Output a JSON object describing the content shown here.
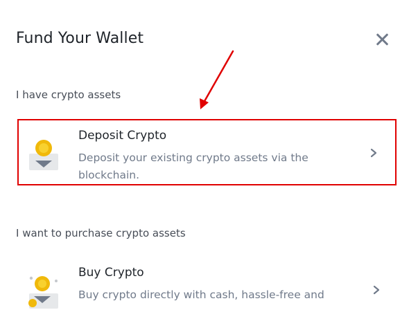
{
  "dialog": {
    "title": "Fund Your Wallet",
    "close_icon": "close-icon"
  },
  "sections": [
    {
      "label": "I have crypto assets",
      "option": {
        "title": "Deposit Crypto",
        "description": "Deposit your existing crypto assets via the blockchain.",
        "icon": "deposit-coin-icon",
        "highlighted": true
      }
    },
    {
      "label": "I want to purchase crypto assets",
      "option": {
        "title": "Buy Crypto",
        "description": "Buy crypto directly with cash, hassle-free and",
        "icon": "buy-coin-icon",
        "highlighted": false
      }
    }
  ],
  "annotation": {
    "arrow_color": "#e00000",
    "highlight_color": "#e00000"
  },
  "colors": {
    "coin": "#f0b90b",
    "tray": "#e6e8ea",
    "arrow_down": "#707a8a",
    "text_secondary": "#707a8a"
  }
}
